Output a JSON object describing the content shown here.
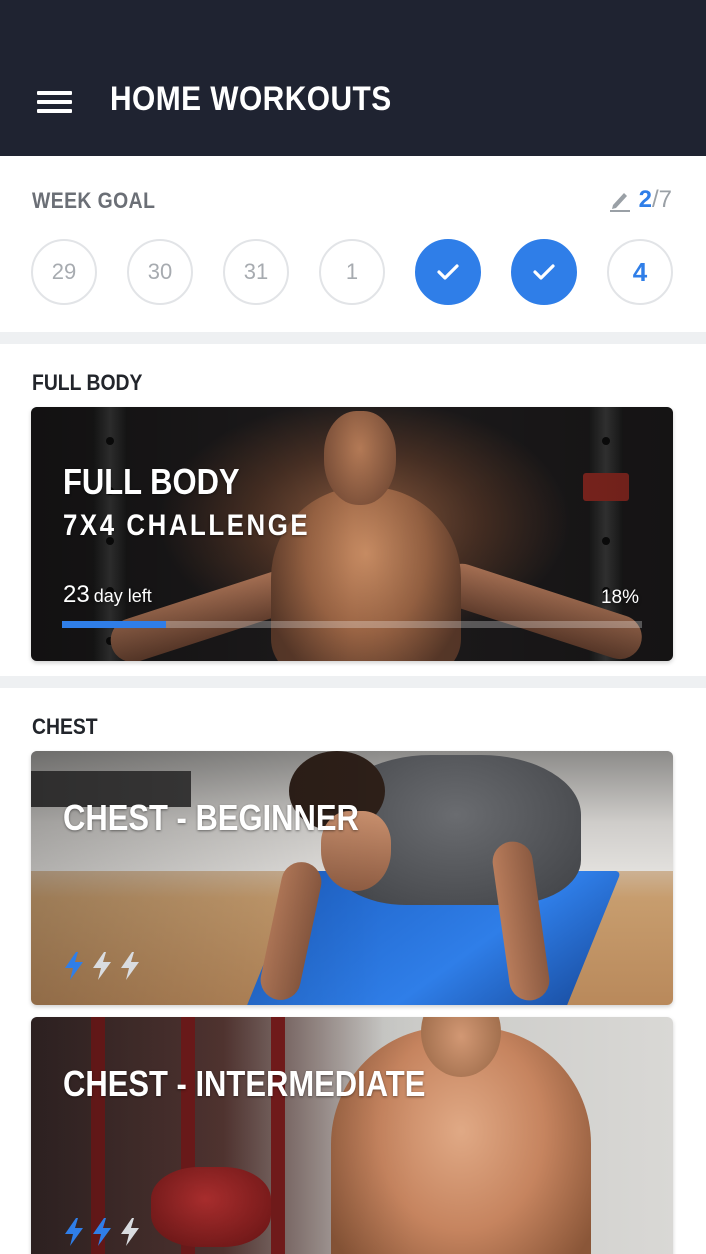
{
  "app": {
    "title": "HOME WORKOUTS"
  },
  "week_goal": {
    "label": "WEEK GOAL",
    "done": "2",
    "separator": "/",
    "total": "7",
    "days": [
      {
        "label": "29",
        "state": "empty"
      },
      {
        "label": "30",
        "state": "empty"
      },
      {
        "label": "31",
        "state": "empty"
      },
      {
        "label": "1",
        "state": "empty"
      },
      {
        "label": "",
        "state": "done"
      },
      {
        "label": "",
        "state": "done"
      },
      {
        "label": "4",
        "state": "today"
      }
    ]
  },
  "sections": {
    "full_body": {
      "title": "FULL BODY",
      "card": {
        "title": "FULL BODY",
        "subtitle": "7X4 CHALLENGE",
        "days_left_number": "23",
        "days_left_unit": "day left",
        "percent_label": "18%",
        "progress": 0.18
      }
    },
    "chest": {
      "title": "CHEST",
      "cards": [
        {
          "title": "CHEST - BEGINNER",
          "level": 1,
          "level_max": 3
        },
        {
          "title": "CHEST - INTERMEDIATE",
          "level": 2,
          "level_max": 3
        }
      ]
    }
  },
  "colors": {
    "appbar": "#1f2331",
    "accent": "#2f7ee8",
    "bolt_active": "#2f7ee8",
    "bolt_inactive": "#d9dce0"
  },
  "icons": {
    "menu": "hamburger-menu-icon",
    "edit": "pencil-icon",
    "done": "checkmark-icon",
    "level": "lightning-bolt-icon"
  }
}
